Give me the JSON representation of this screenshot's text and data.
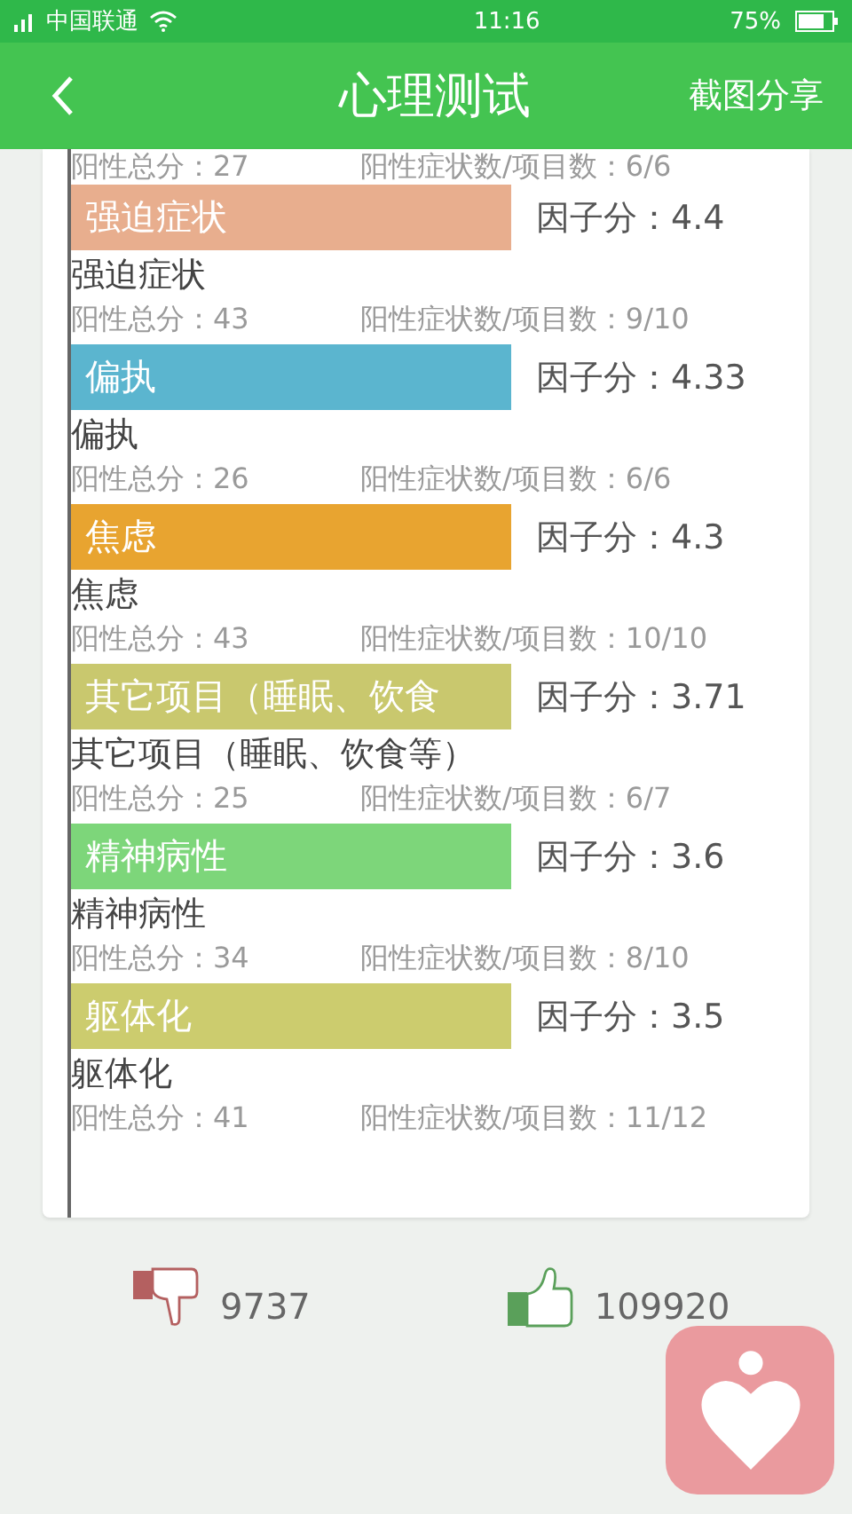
{
  "status_bar": {
    "carrier": "中国联通",
    "time": "11:16",
    "battery": "75%"
  },
  "header": {
    "title": "心理测试",
    "action": "截图分享"
  },
  "partial_stats": {
    "total": "阳性总分：27",
    "ratio": "阳性症状数/项目数：6/6"
  },
  "factors": [
    {
      "bar_label": "强迫症状",
      "factor": "因子分：4.4",
      "color": "#e8ae8e",
      "name": "强迫症状",
      "total": "阳性总分：43",
      "ratio": "阳性症状数/项目数：9/10"
    },
    {
      "bar_label": "偏执",
      "factor": "因子分：4.33",
      "color": "#5bb5cf",
      "name": "偏执",
      "total": "阳性总分：26",
      "ratio": "阳性症状数/项目数：6/6"
    },
    {
      "bar_label": "焦虑",
      "factor": "因子分：4.3",
      "color": "#e8a430",
      "name": "焦虑",
      "total": "阳性总分：43",
      "ratio": "阳性症状数/项目数：10/10"
    },
    {
      "bar_label": "其它项目（睡眠、饮食",
      "factor": "因子分：3.71",
      "color": "#c9c86e",
      "name": "其它项目（睡眠、饮食等）",
      "total": "阳性总分：25",
      "ratio": "阳性症状数/项目数：6/7"
    },
    {
      "bar_label": "精神病性",
      "factor": "因子分：3.6",
      "color": "#7dd67a",
      "name": "精神病性",
      "total": "阳性总分：34",
      "ratio": "阳性症状数/项目数：8/10"
    },
    {
      "bar_label": "躯体化",
      "factor": "因子分：3.5",
      "color": "#cccc6e",
      "name": "躯体化",
      "total": "阳性总分：41",
      "ratio": "阳性症状数/项目数：11/12"
    }
  ],
  "votes": {
    "dislikes": "9737",
    "likes": "109920"
  }
}
